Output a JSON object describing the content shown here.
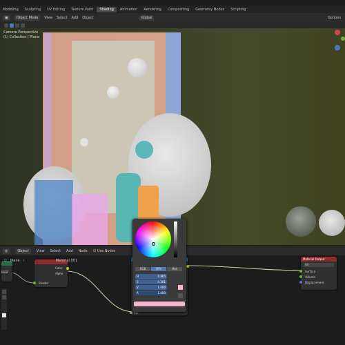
{
  "workspace_tabs": [
    "Modeling",
    "Sculpting",
    "UV Editing",
    "Texture Paint",
    "Shading",
    "Animation",
    "Rendering",
    "Compositing",
    "Geometry Nodes",
    "Scripting"
  ],
  "active_tab": "Shading",
  "viewport_header": {
    "mode": "Object Mode",
    "menus": [
      "View",
      "Select",
      "Add",
      "Object"
    ],
    "transform": "Global",
    "options": "Options"
  },
  "viewport_info": {
    "line1": "Camera Perspective",
    "line2": "(1) Collection | Plane"
  },
  "node_header": {
    "type": "Object",
    "menus": [
      "View",
      "Select",
      "Add",
      "Node"
    ],
    "use_nodes": "Use Nodes"
  },
  "breadcrumb": {
    "object": "Plane",
    "material": "Material.001"
  },
  "nodes": {
    "texcoord": {
      "label": "UV",
      "out": "BSDF"
    },
    "mix": {
      "title": "Mix",
      "in": "Shader",
      "out": "Color",
      "out2": "Alpha"
    },
    "rgb": {
      "out": "Color",
      "out2": "Alpha",
      "in": "Fac"
    },
    "output": {
      "title": "Material Output",
      "target": "All",
      "inputs": [
        "Surface",
        "Volume",
        "Displacement"
      ]
    }
  },
  "picker": {
    "modes": [
      "RGB",
      "HSV",
      "Hex"
    ],
    "active_mode": "HSV",
    "fields": [
      {
        "label": "H",
        "value": "0.865"
      },
      {
        "label": "S",
        "value": "0.261"
      },
      {
        "label": "V",
        "value": "1.000"
      },
      {
        "label": "A",
        "value": "1.000"
      }
    ]
  },
  "colors": {
    "accent": "#4f77b8",
    "node_header_green": "#2a6b3f",
    "node_header_red": "#8e2b2b",
    "picker_swatch": "#f2b6cf"
  }
}
